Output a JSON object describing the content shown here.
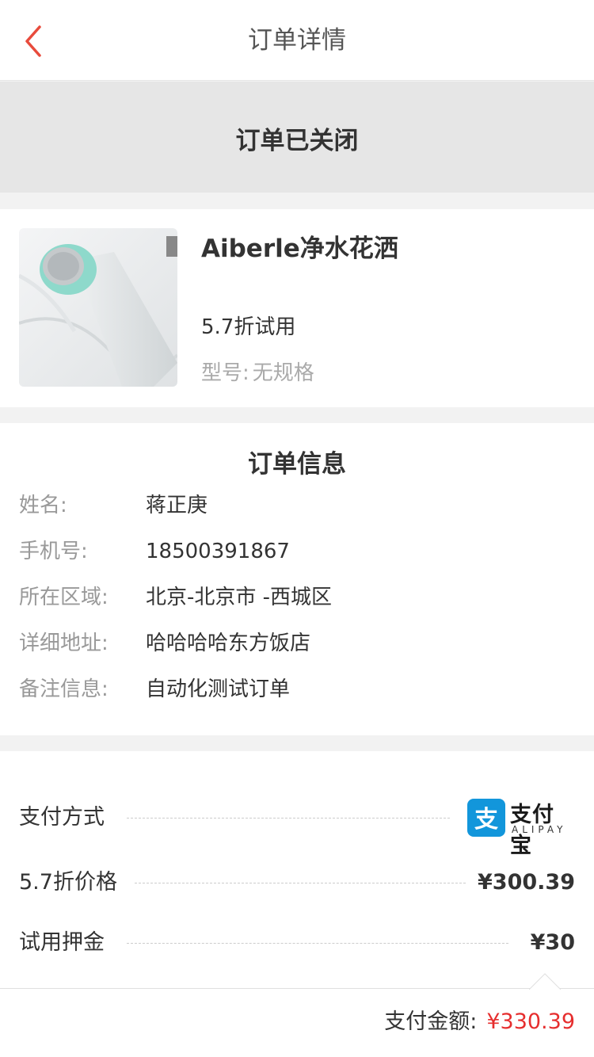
{
  "header": {
    "title": "订单详情"
  },
  "status": {
    "text": "订单已关闭"
  },
  "product": {
    "name": "Aiberle净水花洒",
    "price_text": "5.7折试用",
    "spec_label": "型号:",
    "spec_value": "无规格"
  },
  "order_info": {
    "title": "订单信息",
    "rows": [
      {
        "label": "姓名:",
        "value": "蒋正庚"
      },
      {
        "label": "手机号:",
        "value": "18500391867"
      },
      {
        "label": "所在区域:",
        "value": "北京-北京市 -西城区"
      },
      {
        "label": "详细地址:",
        "value": "哈哈哈哈东方饭店"
      },
      {
        "label": "备注信息:",
        "value": "自动化测试订单"
      }
    ]
  },
  "payment": {
    "method_label": "支付方式",
    "method_logo_cn": "支付宝",
    "method_logo_en": "ALIPAY",
    "discount_label": "5.7折价格",
    "discount_value": "¥300.39",
    "deposit_label": "试用押金",
    "deposit_value": "¥30"
  },
  "footer": {
    "total_label": "支付金额:",
    "total_value": "¥330.39"
  },
  "colors": {
    "accent": "#e62e2e",
    "alipay": "#1296db"
  }
}
